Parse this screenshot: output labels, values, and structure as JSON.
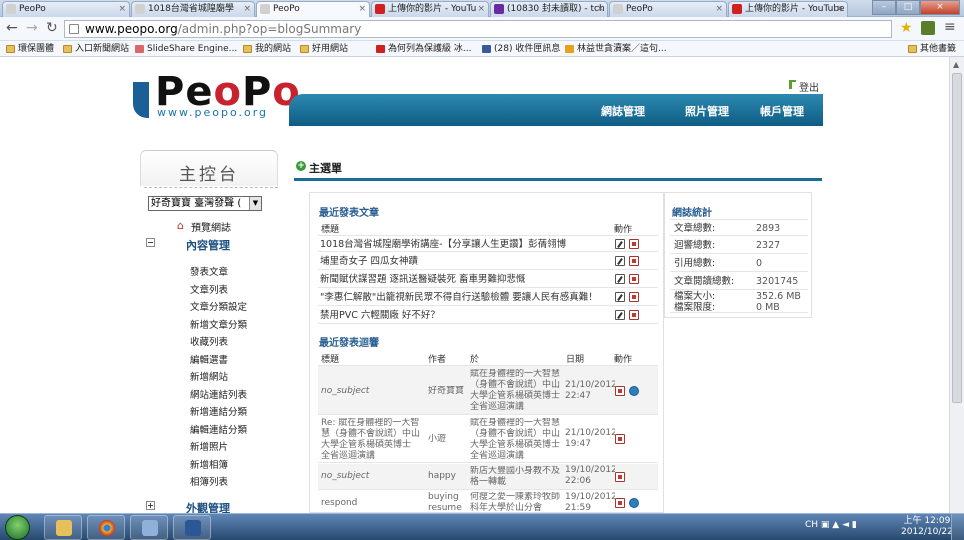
{
  "browser": {
    "tabs": [
      {
        "label": "PeoPo",
        "active": false
      },
      {
        "label": "1018台灣省城隍廟學",
        "active": false
      },
      {
        "label": "PeoPo",
        "active": true
      },
      {
        "label": "上傳你的影片 - YouTu",
        "active": false
      },
      {
        "label": "(10830 封未讀取) - tch",
        "active": false
      },
      {
        "label": "PeoPo",
        "active": false
      },
      {
        "label": "上傳你的影片 - YouTube",
        "active": false
      }
    ],
    "url_host": "www.peopo.org",
    "url_rest": "/admin.php?op=blogSummary",
    "bookmarks": [
      "環保團體",
      "入口新聞網站",
      "SlideShare Engine...",
      "我的網站",
      "好用網站",
      "為何列為保護級 冰...",
      "(28) 收件匣訊息",
      "林益世貪瀆案／這句..."
    ],
    "other_bookmarks": "其他書籤"
  },
  "site": {
    "logo_text": "PeoPo",
    "logo_sub": "www.peopo.org",
    "logout": "登出",
    "nav": [
      "網誌管理",
      "照片管理",
      "帳戶管理"
    ]
  },
  "sidebar": {
    "title": "主控台",
    "blog_select": "好奇寶寶 臺灣發聲 (",
    "preview": "預覽網誌",
    "section_content": "內容管理",
    "links": [
      "發表文章",
      "文章列表",
      "文章分類設定",
      "新增文章分類",
      "收藏列表",
      "編輯選書",
      "新增網站",
      "網站連結列表",
      "新增連結分類",
      "編輯連結分類",
      "新增照片",
      "新增相簿",
      "相簿列表"
    ],
    "section_appearance": "外觀管理"
  },
  "main": {
    "title": "主選單",
    "recent_posts": {
      "title": "最近發表文章",
      "col_title": "標題",
      "col_action": "動作",
      "rows": [
        "1018台灣省城隍廟學術講座-【分享讓人生更讚】彭蒨翎博",
        "埔里奇女子 四瓜女神蹟",
        "新聞賦伏謀習題 逐訊送醫疑裝死 畜車男難抑悲慨",
        "\"李惠仁解散\"出籠視新民眾不得自行送驗檢體 要讓人民有感真難！",
        "禁用PVC 六輕關廠 好不好？"
      ]
    },
    "recent_comments": {
      "title": "最近發表迴響",
      "cols": [
        "標題",
        "作者",
        "於",
        "日期",
        "動作"
      ],
      "rows": [
        {
          "title": "no_subject",
          "author": "好奇寶寶",
          "post": "賦在身體裡的一大智慧（身體不會說謊）中山大學企管系楊碩英博士 全省巡迴演講",
          "date": "21/10/2012 22:47",
          "view": true
        },
        {
          "title": "Re: 賦在身體裡的一大智慧（身體不會說謊）中山大學企管系楊碩英博士 全省巡迴演講",
          "author": "小遊",
          "post": "賦在身體裡的一大智慧（身體不會說謊）中山大學企管系楊碩英博士 全省巡迴演講",
          "date": "21/10/2012 19:47",
          "view": false
        },
        {
          "title": "no_subject",
          "author": "happy",
          "post": "新店大豐國小身教不及格一轉載",
          "date": "19/10/2012 22:06",
          "view": false
        },
        {
          "title": "respond",
          "author": "buying resume",
          "post": "何瘦之愛一陳素玲牧師 科年大學於山分會",
          "date": "19/10/2012 21:59",
          "view": true
        }
      ]
    },
    "stats": {
      "title": "網誌統計",
      "rows": [
        {
          "k": "文章總數:",
          "v": "2893"
        },
        {
          "k": "迴響總數:",
          "v": "2327"
        },
        {
          "k": "引用總數:",
          "v": "0"
        },
        {
          "k": "文章閱讀總數:",
          "v": "3201745"
        },
        {
          "k": "檔案大小:",
          "v": "352.6 MB"
        },
        {
          "k": "檔案限度:",
          "v": "0 MB"
        }
      ]
    }
  },
  "taskbar": {
    "tray": "CH",
    "time": "上午 12:09",
    "date": "2012/10/22"
  },
  "colors": {
    "accent": "#1c6a96",
    "logo_red": "#c8222e",
    "link_blue": "#2a5f92"
  }
}
